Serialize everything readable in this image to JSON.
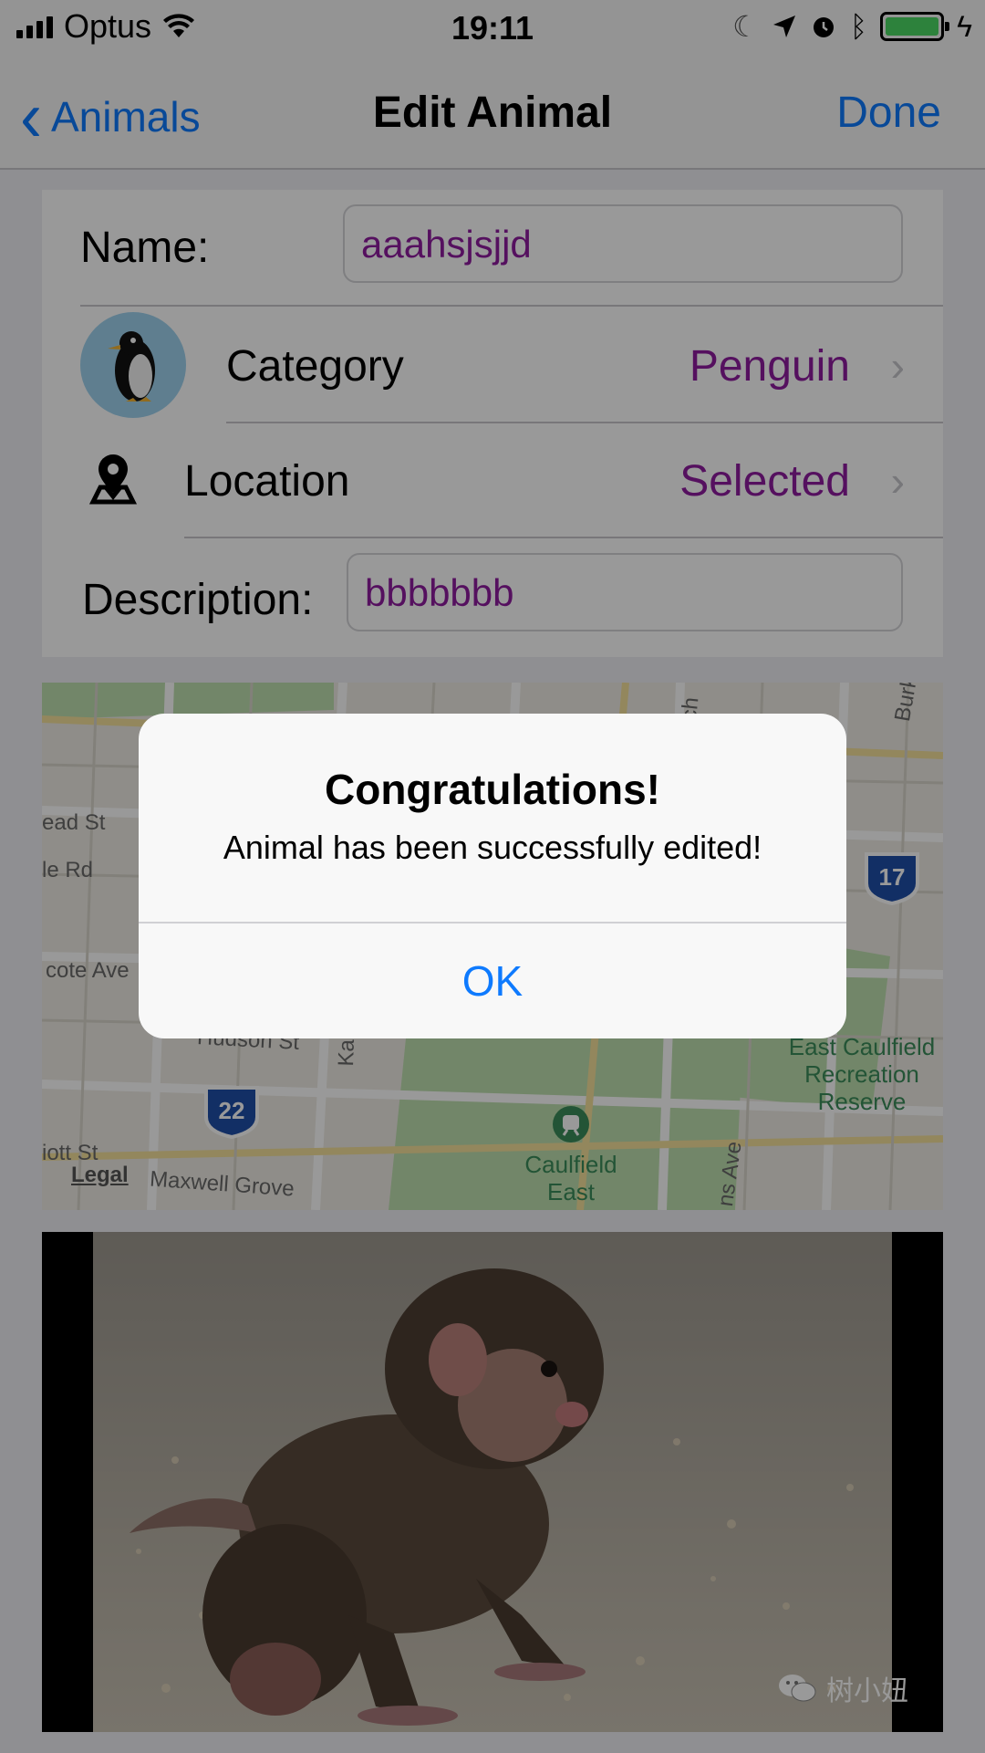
{
  "status_bar": {
    "carrier": "Optus",
    "time": "19:11",
    "battery_color": "#4cd964"
  },
  "nav": {
    "back_label": "Animals",
    "title": "Edit Animal",
    "done_label": "Done"
  },
  "form": {
    "name_label": "Name:",
    "name_value": "aaahsjsjjd",
    "category_label": "Category",
    "category_value": "Penguin",
    "location_label": "Location",
    "location_value": "Selected",
    "description_label": "Description:",
    "description_value": "bbbbbbb",
    "value_color": "#8e1b9e"
  },
  "map": {
    "labels": [
      "ead St",
      "le Rd",
      "cote Ave",
      "iott St",
      "Maxwell Grove",
      "Burke Rd",
      "Kam",
      "ns Ave",
      "Hudson St",
      "ch"
    ],
    "legal": "Legal",
    "route_17": "17",
    "route_22": "22",
    "park_east": "East Caulfield Recreation Reserve",
    "station": "Caulfield East"
  },
  "alert": {
    "title": "Congratulations!",
    "message": "Animal has been successfully edited!",
    "ok_label": "OK"
  },
  "watermark": "树小妞",
  "accent_color": "#0e7afe"
}
